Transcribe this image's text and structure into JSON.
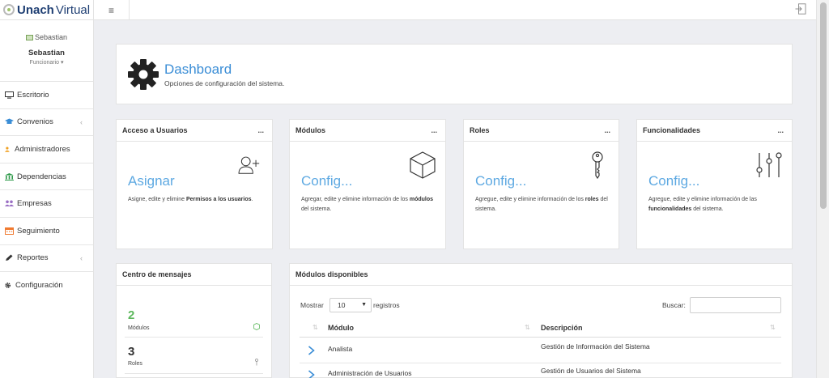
{
  "app": {
    "logo_bold": "Unach",
    "logo_light": "Virtual"
  },
  "profile": {
    "avatar_alt": "Sebastian",
    "name": "Sebastian",
    "role": "Funcionario ▾"
  },
  "sidebar": {
    "items": [
      {
        "label": "Escritorio",
        "icon": "desktop-icon",
        "color": "#333333"
      },
      {
        "label": "Convenios",
        "icon": "graduation-cap-icon",
        "color": "#3a8dd6",
        "has_chevron": true
      },
      {
        "label": "Administradores",
        "icon": "user-icon",
        "color": "#f0a020"
      },
      {
        "label": "Dependencias",
        "icon": "building-icon",
        "color": "#2e9a4a"
      },
      {
        "label": "Empresas",
        "icon": "users-icon",
        "color": "#9a6fc4"
      },
      {
        "label": "Seguimiento",
        "icon": "calendar-icon",
        "color": "#f07a30"
      },
      {
        "label": "Reportes",
        "icon": "pencil-icon",
        "color": "#333333",
        "has_chevron": true
      },
      {
        "label": "Configuración",
        "icon": "gear-icon",
        "color": "#333333"
      }
    ],
    "chevron": "‹"
  },
  "topbar": {
    "menu_icon": "≡"
  },
  "dashboard": {
    "title": "Dashboard",
    "subtitle": "Opciones de configuración del sistema."
  },
  "cards": [
    {
      "title": "Acceso a Usuarios",
      "dots": "...",
      "big": "Asignar",
      "icon": "user-add-icon",
      "desc_pre": "Asigne, edite y elimine ",
      "desc_bold": "Permisos a los usuarios",
      "desc_post": "."
    },
    {
      "title": "Módulos",
      "dots": "...",
      "big": "Config...",
      "icon": "cube-icon",
      "desc_pre": "Agregar, edite y elimine información de los ",
      "desc_bold": "módulos",
      "desc_post": " del sistema."
    },
    {
      "title": "Roles",
      "dots": "...",
      "big": "Config...",
      "icon": "key-icon",
      "desc_pre": "Agregue, edite y elimine información de los ",
      "desc_bold": "roles",
      "desc_post": " del sistema."
    },
    {
      "title": "Funcionalidades",
      "dots": "...",
      "big": "Config...",
      "icon": "sliders-icon",
      "desc_pre": "Agregue, edite y elimine información de las ",
      "desc_bold": "funcionalidades",
      "desc_post": " del sistema."
    }
  ],
  "messages": {
    "title": "Centro de mensajes",
    "stats": [
      {
        "value": "2",
        "label": "Módulos",
        "color": "#5cb85c",
        "icon": "cube-icon"
      },
      {
        "value": "3",
        "label": "Roles",
        "color": "#333333",
        "icon": "key-icon"
      }
    ]
  },
  "modules": {
    "title": "Módulos disponibles",
    "show_label": "Mostrar",
    "page_size": "10",
    "records_label": "registros",
    "search_label": "Buscar:",
    "search_value": "",
    "columns": [
      "Módulo",
      "Descripción"
    ],
    "rows": [
      {
        "modulo": "Analista",
        "descripcion": "Gestión de Información del Sistema"
      },
      {
        "modulo": "Administración de Usuarios",
        "descripcion": "Gestión de Usuarios del Sistema"
      }
    ]
  }
}
